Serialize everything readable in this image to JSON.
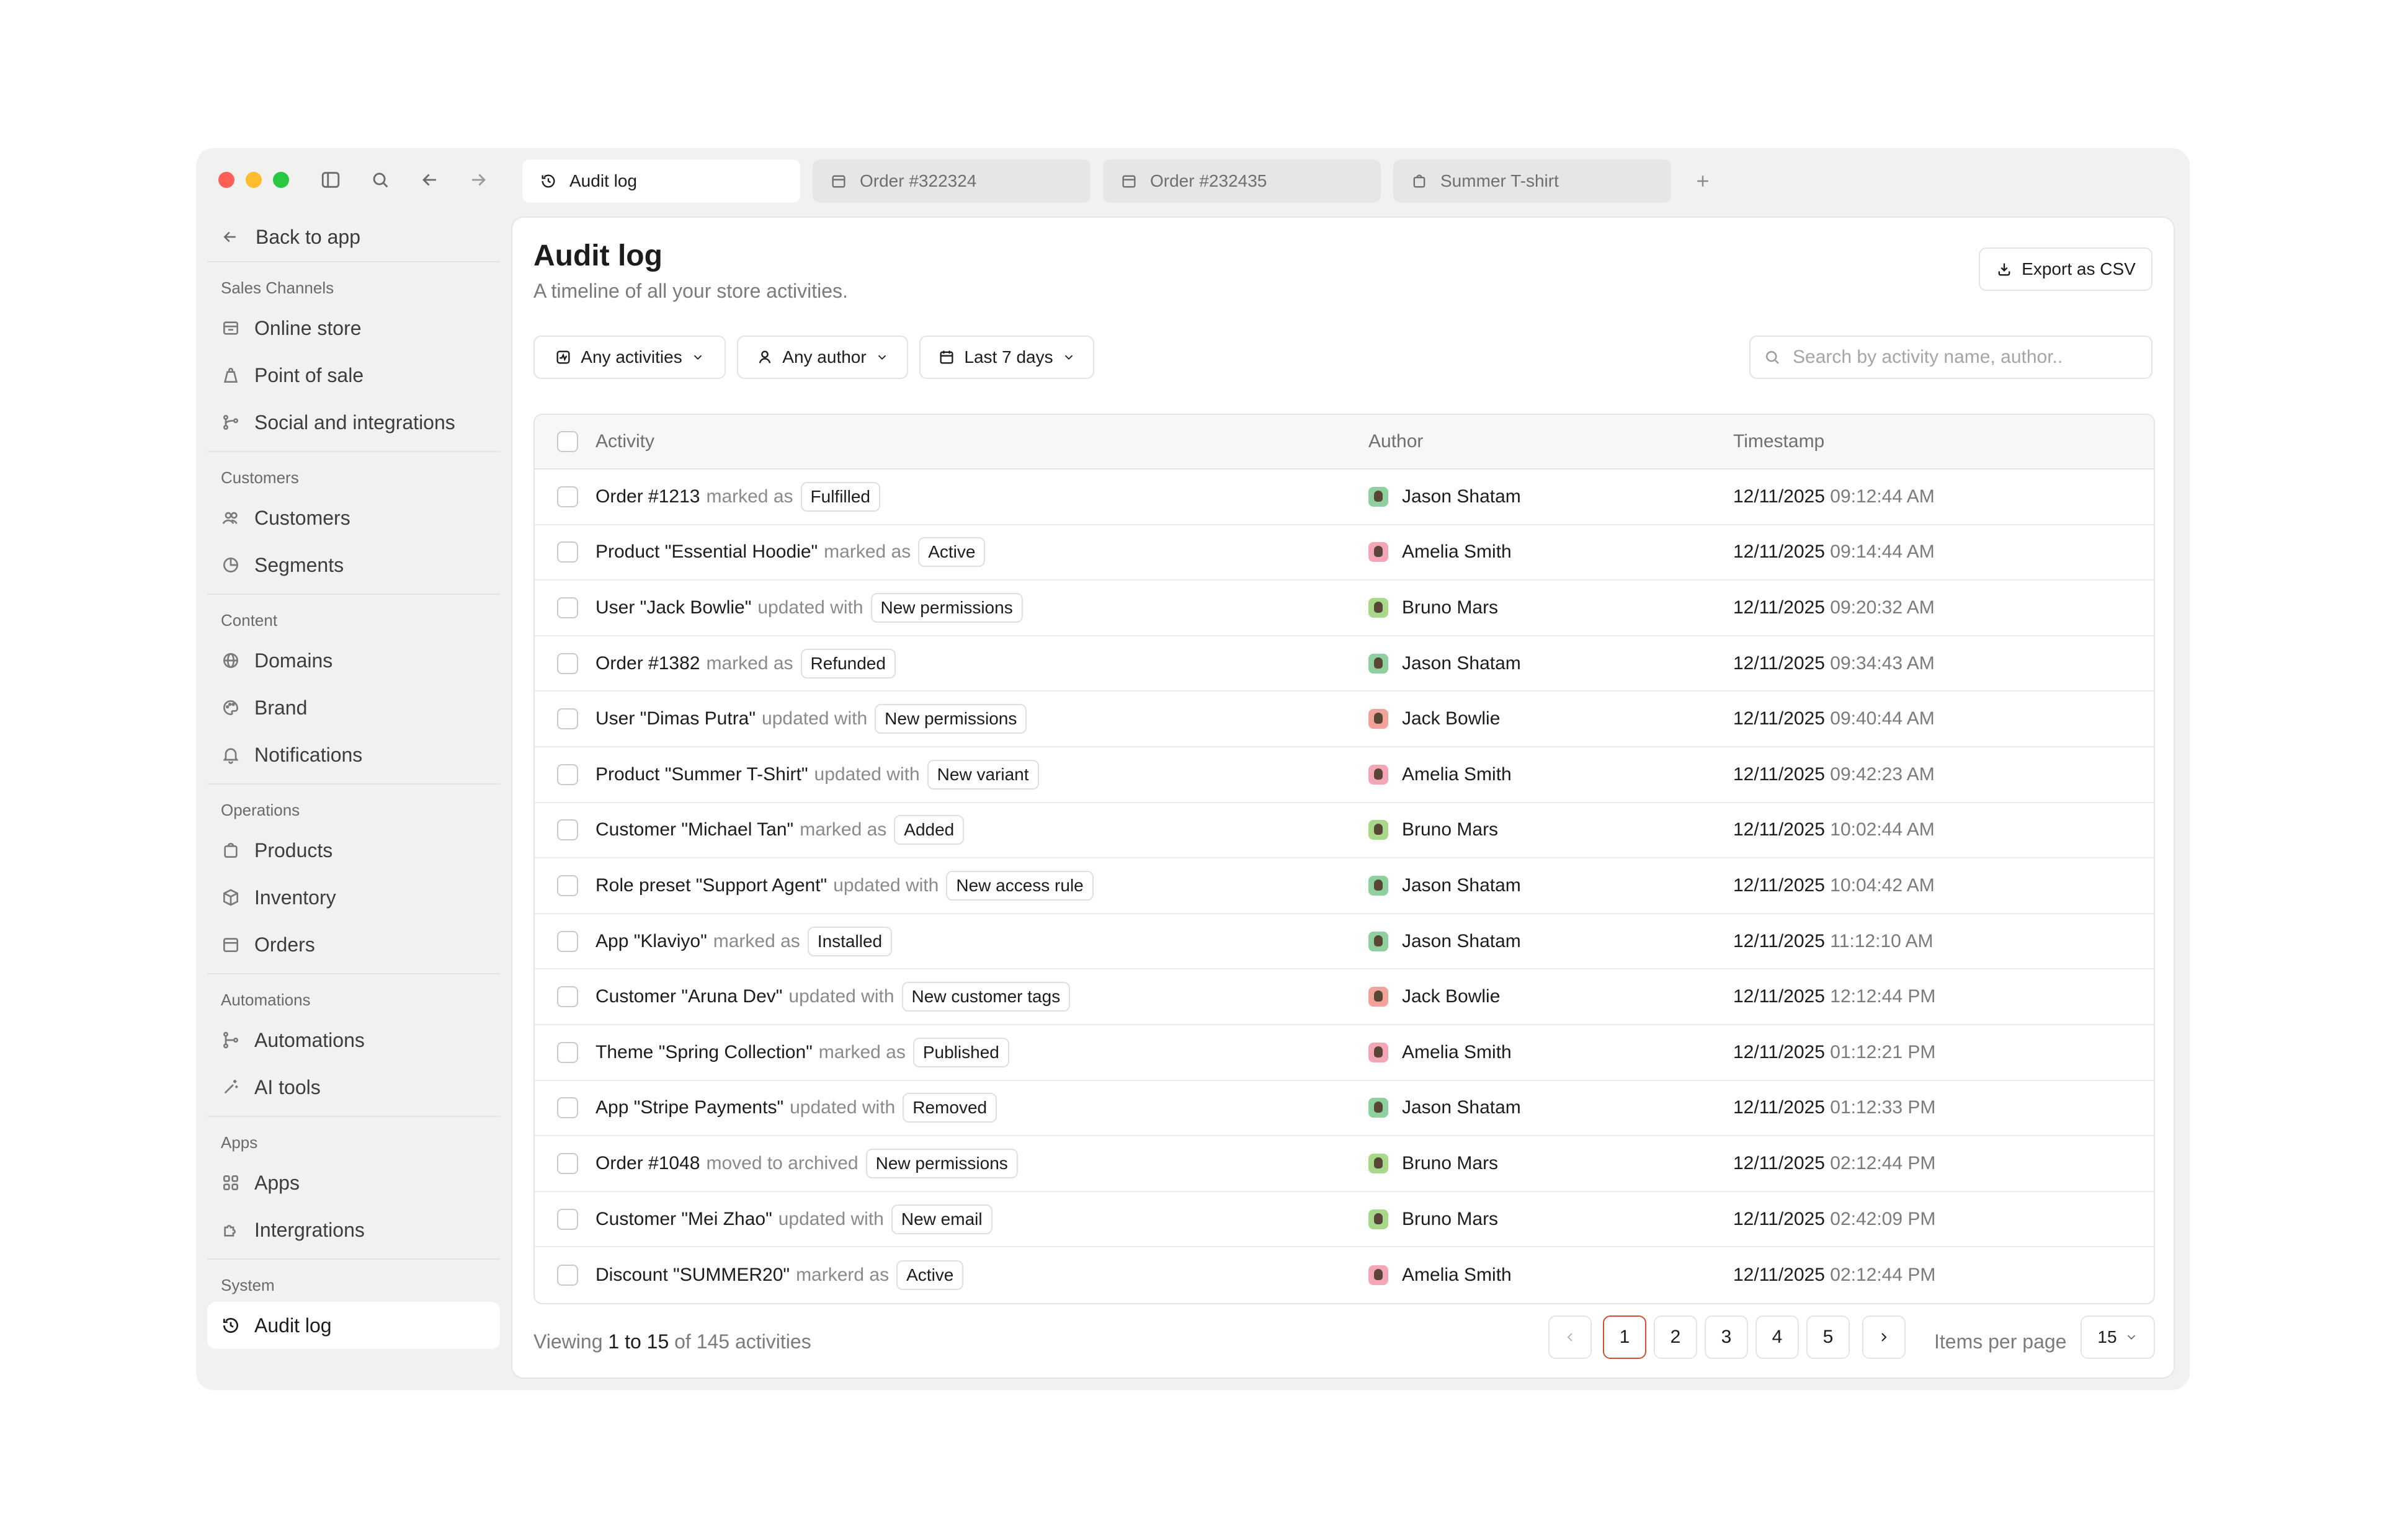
{
  "tabs": [
    {
      "label": "Audit log",
      "icon": "history-icon",
      "active": true
    },
    {
      "label": "Order #322324",
      "icon": "calendar-icon",
      "active": false
    },
    {
      "label": "Order #232435",
      "icon": "calendar-icon",
      "active": false
    },
    {
      "label": "Summer T-shirt",
      "icon": "bag-icon",
      "active": false
    }
  ],
  "sidebar": {
    "back_label": "Back to app",
    "sections": [
      {
        "label": "Sales Channels",
        "items": [
          {
            "label": "Online store",
            "icon": "store-icon"
          },
          {
            "label": "Point of sale",
            "icon": "tag-icon"
          },
          {
            "label": "Social and integrations",
            "icon": "branch-icon"
          }
        ]
      },
      {
        "label": "Customers",
        "items": [
          {
            "label": "Customers",
            "icon": "users-icon"
          },
          {
            "label": "Segments",
            "icon": "pie-icon"
          }
        ]
      },
      {
        "label": "Content",
        "items": [
          {
            "label": "Domains",
            "icon": "globe-icon"
          },
          {
            "label": "Brand",
            "icon": "palette-icon"
          },
          {
            "label": "Notifications",
            "icon": "bell-icon"
          }
        ]
      },
      {
        "label": "Operations",
        "items": [
          {
            "label": "Products",
            "icon": "bag-icon"
          },
          {
            "label": "Inventory",
            "icon": "box-icon"
          },
          {
            "label": "Orders",
            "icon": "calendar-icon"
          }
        ]
      },
      {
        "label": "Automations",
        "items": [
          {
            "label": "Automations",
            "icon": "flow-icon"
          },
          {
            "label": "AI tools",
            "icon": "wand-icon"
          }
        ]
      },
      {
        "label": "Apps",
        "items": [
          {
            "label": "Apps",
            "icon": "grid-icon"
          },
          {
            "label": "Intergrations",
            "icon": "puzzle-icon"
          }
        ]
      },
      {
        "label": "System",
        "items": [
          {
            "label": "Audit log",
            "icon": "history-icon",
            "active": true
          }
        ]
      }
    ]
  },
  "main": {
    "title": "Audit log",
    "subtitle": "A timeline of all your store activities.",
    "export_label": "Export as CSV",
    "filters": {
      "activities": "Any activities",
      "author": "Any author",
      "range": "Last 7 days"
    },
    "search_placeholder": "Search by activity name, author..",
    "columns": {
      "activity": "Activity",
      "author": "Author",
      "timestamp": "Timestamp"
    },
    "rows": [
      {
        "subject": "Order #1213",
        "verb": "marked as",
        "badge": "Fulfilled",
        "author": "Jason Shatam",
        "avatar_color": "#8fd19e",
        "date": "12/11/2025",
        "time": "09:12:44 AM"
      },
      {
        "subject": "Product \"Essential Hoodie\"",
        "verb": "marked as",
        "badge": "Active",
        "author": "Amelia Smith",
        "avatar_color": "#f4a6b8",
        "date": "12/11/2025",
        "time": "09:14:44 AM"
      },
      {
        "subject": "User \"Jack Bowlie\"",
        "verb": "updated with",
        "badge": "New permissions",
        "author": "Bruno Mars",
        "avatar_color": "#a8d98a",
        "date": "12/11/2025",
        "time": "09:20:32 AM"
      },
      {
        "subject": "Order #1382",
        "verb": "marked as",
        "badge": "Refunded",
        "author": "Jason Shatam",
        "avatar_color": "#8fd19e",
        "date": "12/11/2025",
        "time": "09:34:43 AM"
      },
      {
        "subject": "User \"Dimas Putra\"",
        "verb": "updated with",
        "badge": "New permissions",
        "author": "Jack Bowlie",
        "avatar_color": "#f2a39a",
        "date": "12/11/2025",
        "time": "09:40:44 AM"
      },
      {
        "subject": "Product \"Summer T-Shirt\"",
        "verb": "updated with",
        "badge": "New variant",
        "author": "Amelia Smith",
        "avatar_color": "#f4a6b8",
        "date": "12/11/2025",
        "time": "09:42:23 AM"
      },
      {
        "subject": "Customer \"Michael Tan\"",
        "verb": "marked as",
        "badge": "Added",
        "author": "Bruno Mars",
        "avatar_color": "#a8d98a",
        "date": "12/11/2025",
        "time": "10:02:44 AM"
      },
      {
        "subject": "Role preset \"Support Agent\"",
        "verb": "updated with",
        "badge": "New access rule",
        "author": "Jason Shatam",
        "avatar_color": "#8fd19e",
        "date": "12/11/2025",
        "time": "10:04:42 AM"
      },
      {
        "subject": "App \"Klaviyo\"",
        "verb": "marked as",
        "badge": "Installed",
        "author": "Jason Shatam",
        "avatar_color": "#8fd19e",
        "date": "12/11/2025",
        "time": "11:12:10 AM"
      },
      {
        "subject": "Customer \"Aruna Dev\"",
        "verb": "updated with",
        "badge": "New customer tags",
        "author": "Jack Bowlie",
        "avatar_color": "#f2a39a",
        "date": "12/11/2025",
        "time": "12:12:44 PM"
      },
      {
        "subject": "Theme \"Spring Collection\"",
        "verb": "marked as",
        "badge": "Published",
        "author": "Amelia Smith",
        "avatar_color": "#f4a6b8",
        "date": "12/11/2025",
        "time": "01:12:21 PM"
      },
      {
        "subject": "App \"Stripe Payments\"",
        "verb": "updated with",
        "badge": "Removed",
        "author": "Jason Shatam",
        "avatar_color": "#8fd19e",
        "date": "12/11/2025",
        "time": "01:12:33 PM"
      },
      {
        "subject": "Order #1048",
        "verb": "moved to archived",
        "badge": "New permissions",
        "author": "Bruno Mars",
        "avatar_color": "#a8d98a",
        "date": "12/11/2025",
        "time": "02:12:44 PM"
      },
      {
        "subject": "Customer \"Mei Zhao\"",
        "verb": "updated with",
        "badge": "New email",
        "author": "Bruno Mars",
        "avatar_color": "#a8d98a",
        "date": "12/11/2025",
        "time": "02:42:09 PM"
      },
      {
        "subject": "Discount \"SUMMER20\"",
        "verb": "markerd as",
        "badge": "Active",
        "author": "Amelia Smith",
        "avatar_color": "#f4a6b8",
        "date": "12/11/2025",
        "time": "02:12:44 PM"
      }
    ],
    "footer": {
      "viewing_prefix": "Viewing",
      "from": "1",
      "to_word": "to",
      "to": "15",
      "of_text": "of 145 activities",
      "pages": [
        "1",
        "2",
        "3",
        "4",
        "5"
      ],
      "current_page": "1",
      "items_per_page_label": "Items per page",
      "items_per_page": "15"
    }
  },
  "colors": {
    "accent": "#d0502c",
    "window_bg": "#f1f1f0"
  }
}
